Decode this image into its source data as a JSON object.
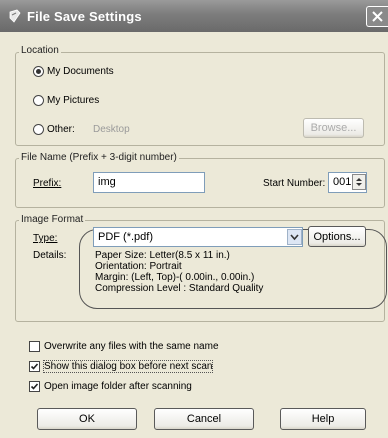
{
  "window": {
    "title": "File Save Settings"
  },
  "location": {
    "legend": "Location",
    "options": [
      "My Documents",
      "My Pictures",
      "Other:"
    ],
    "selected": "My Documents",
    "other_path": "Desktop",
    "browse_label": "Browse..."
  },
  "file_name": {
    "legend": "File Name (Prefix + 3-digit number)",
    "prefix_label": "Prefix:",
    "prefix_value": "img",
    "start_number_label": "Start Number:",
    "start_number_value": "001"
  },
  "image_format": {
    "legend": "Image Format",
    "type_label": "Type:",
    "type_value": "PDF (*.pdf)",
    "options_label": "Options...",
    "details_label": "Details:",
    "details": [
      "Paper Size: Letter(8.5 x 11 in.)",
      "Orientation: Portrait",
      "Margin: (Left, Top)-( 0.00in., 0.00in.)",
      "Compression Level : Standard Quality"
    ]
  },
  "checkboxes": [
    {
      "label": "Overwrite any files with the same name",
      "checked": false
    },
    {
      "label": "Show this dialog box before next scan",
      "checked": true
    },
    {
      "label": "Open image folder after scanning",
      "checked": true
    }
  ],
  "buttons": {
    "ok": "OK",
    "cancel": "Cancel",
    "help": "Help"
  },
  "icons": {
    "title_icon": "scanner-icon",
    "close": "close-icon",
    "dropdown": "chevron-down-icon",
    "spin": "spin-updown-icon"
  }
}
